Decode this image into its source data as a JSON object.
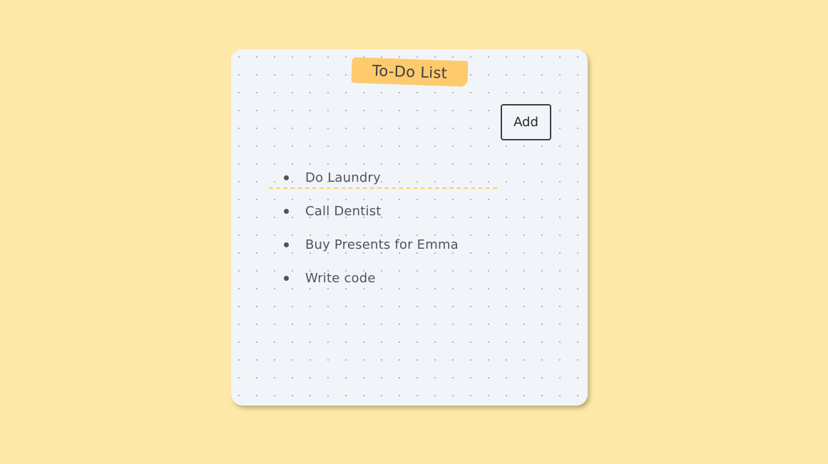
{
  "colors": {
    "background": "#ffe9a8",
    "card": "#f1f5f9",
    "accent": "#fdca6e",
    "text": "#52525b"
  },
  "card": {
    "title": "To-Do List",
    "input": {
      "value": "",
      "placeholder": ""
    },
    "add_button_label": "Add",
    "items": [
      {
        "label": "Do Laundry"
      },
      {
        "label": "Call Dentist"
      },
      {
        "label": "Buy Presents for Emma"
      },
      {
        "label": "Write code"
      }
    ]
  }
}
